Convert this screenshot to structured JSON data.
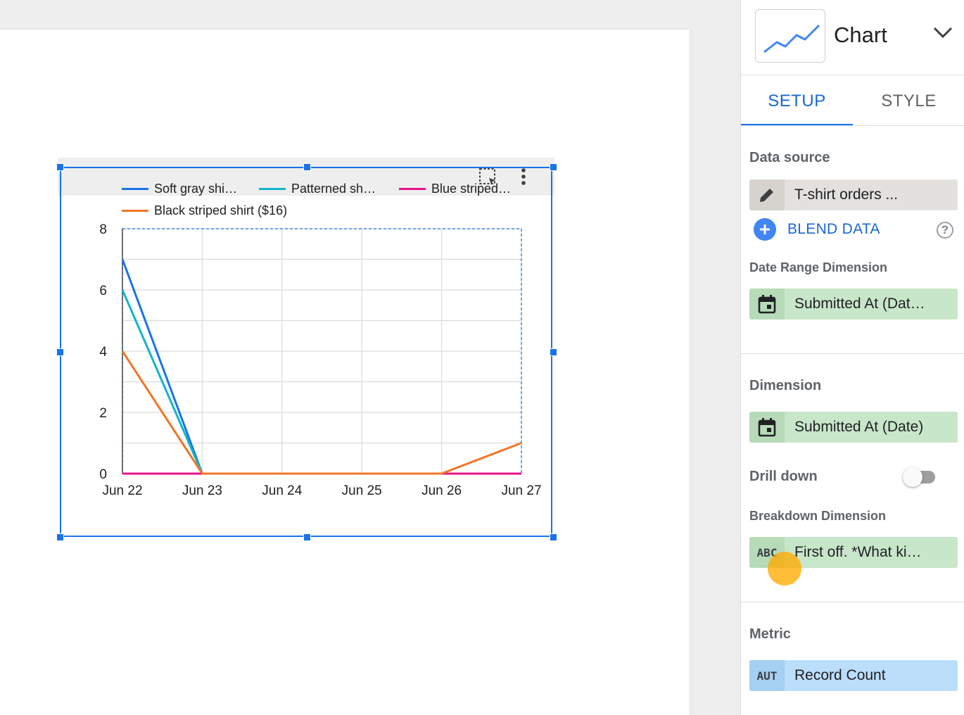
{
  "canvas": {
    "toolbar": {
      "select_icon": "select-area-icon",
      "more_icon": "more-vertical-icon"
    }
  },
  "chart_data": {
    "type": "line",
    "x": [
      "Jun 22",
      "Jun 23",
      "Jun 24",
      "Jun 25",
      "Jun 26",
      "Jun 27"
    ],
    "yticks": [
      "0",
      "2",
      "4",
      "6",
      "8"
    ],
    "ylim": [
      0,
      8
    ],
    "grid": true,
    "legend_position": "top",
    "series": [
      {
        "name": "Soft gray shi…",
        "color": "#1a73e8",
        "values": [
          7,
          0,
          0,
          0,
          0,
          0
        ]
      },
      {
        "name": "Patterned sh…",
        "color": "#12b5cb",
        "values": [
          6,
          0,
          0,
          0,
          0,
          0
        ]
      },
      {
        "name": "Blue striped…",
        "color": "#e8128c",
        "values": [
          0,
          0,
          0,
          0,
          0,
          0
        ]
      },
      {
        "name": "Black striped shirt ($16)",
        "color": "#f07627",
        "values": [
          4,
          0,
          0,
          0,
          0,
          1
        ]
      }
    ]
  },
  "panel": {
    "chart_type": {
      "label": "Chart",
      "icon": "line-chart-icon"
    },
    "tabs": [
      {
        "label": "SETUP"
      },
      {
        "label": "STYLE"
      }
    ],
    "data_source": {
      "label": "Data source",
      "value": "T-shirt orders ..."
    },
    "blend_data": {
      "label": "BLEND DATA",
      "help": "?"
    },
    "date_range": {
      "label": "Date Range Dimension",
      "value": "Submitted At (Dat…"
    },
    "dimension": {
      "label": "Dimension",
      "value": "Submitted At (Date)"
    },
    "drill_down": {
      "label": "Drill down",
      "enabled": false
    },
    "breakdown": {
      "label": "Breakdown Dimension",
      "badge": "ABC",
      "value": "First off. *What ki…"
    },
    "metric": {
      "label": "Metric",
      "badge": "AUT",
      "value": "Record Count"
    }
  }
}
